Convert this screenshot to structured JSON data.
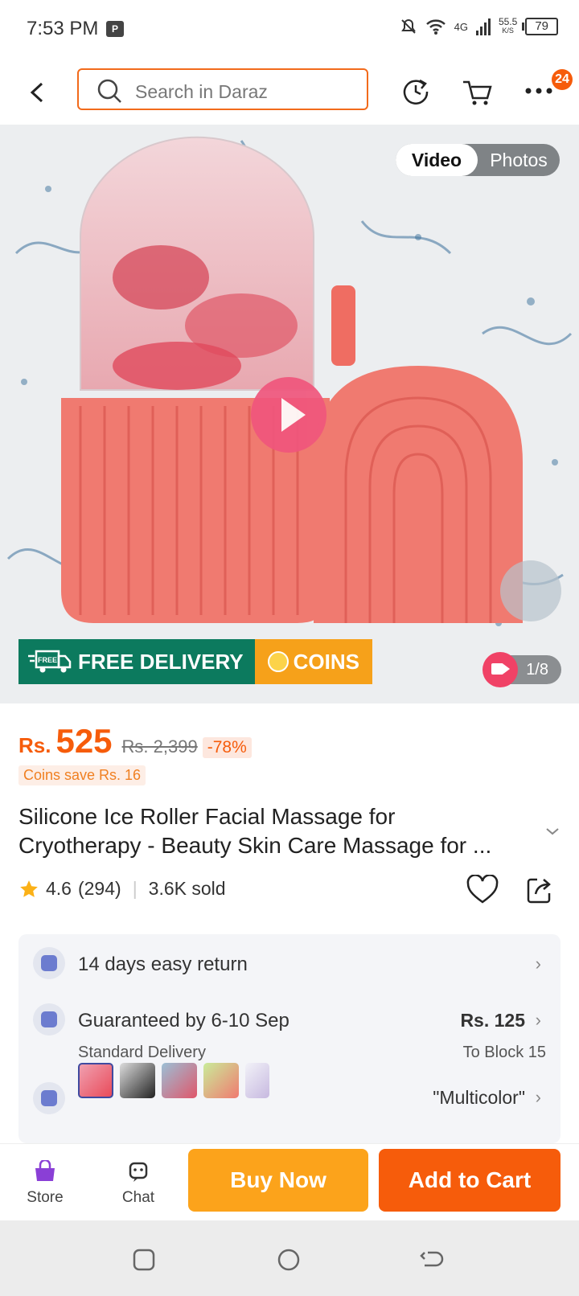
{
  "status_bar": {
    "time": "7:53 PM",
    "network": "4G",
    "speed": "55.5",
    "speed_unit": "K/S",
    "battery": "79"
  },
  "header": {
    "search_placeholder": "Search in Daraz",
    "more_badge": "24"
  },
  "gallery": {
    "toggle": {
      "video": "Video",
      "photos": "Photos",
      "active": "Video"
    },
    "promo_free_delivery": "FREE DELIVERY",
    "promo_free_tag": "FREE",
    "promo_coins": "COINS",
    "counter": "1/8"
  },
  "product": {
    "currency": "Rs.",
    "price": "525",
    "original_price": "Rs. 2,399",
    "discount": "-78%",
    "coins_save": "Coins save Rs. 16",
    "title_line1": "Silicone Ice Roller Facial Massage for",
    "title_line2": "Cryotherapy - Beauty Skin Care Massage for ...",
    "rating": "4.6",
    "reviews": "(294)",
    "sold": "3.6K sold"
  },
  "service": {
    "return": "14 days easy return",
    "delivery_title": "Guaranteed by 6-10 Sep",
    "delivery_type": "Standard Delivery",
    "delivery_fee": "Rs. 125",
    "delivery_to": "To Block 15",
    "variant": "\"Multicolor\""
  },
  "bottom_bar": {
    "store": "Store",
    "chat": "Chat",
    "buy_now": "Buy Now",
    "add_to_cart": "Add to Cart"
  },
  "colors": {
    "accent": "#f65c0b",
    "buy": "#fca31b",
    "free_delivery": "#0c7a5e",
    "coins": "#f6a11a"
  }
}
